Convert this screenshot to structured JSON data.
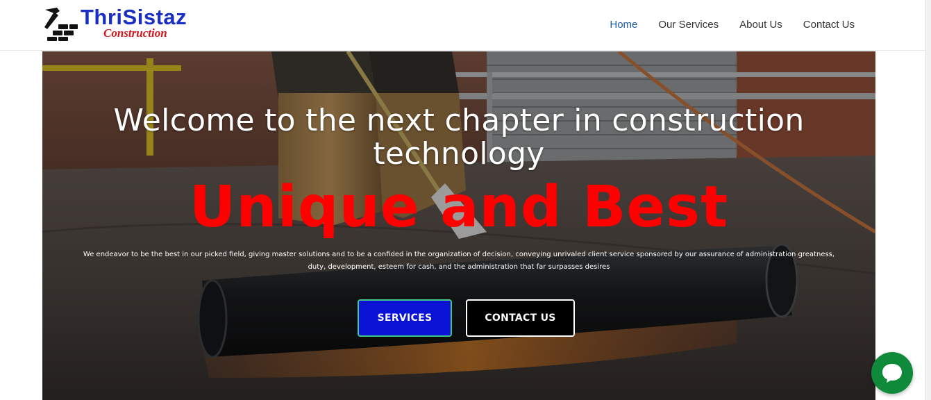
{
  "brand": {
    "name": "ThriSistaz",
    "subtitle": "Construction"
  },
  "nav": {
    "items": [
      {
        "label": "Home",
        "active": true
      },
      {
        "label": "Our Services",
        "active": false
      },
      {
        "label": "About Us",
        "active": false
      },
      {
        "label": "Contact Us",
        "active": false
      }
    ]
  },
  "hero": {
    "headline": "Welcome to the next chapter in construction technology",
    "tagline": "Unique and Best",
    "description": "We endeavor to be the best in our picked field, giving master solutions and to be a confided in the organization of decision, conveying unrivaled client service sponsored by our assurance of administration greatness, duty, development, esteem for cash, and the administration that far surpasses desires",
    "buttons": {
      "services": "SERVICES",
      "contact": "CONTACT US"
    }
  },
  "colors": {
    "brand_blue": "#1b2ec4",
    "brand_red": "#d4141a",
    "nav_active": "#1f5aa6",
    "tagline_red": "#ff0000",
    "services_button": "#0a12d6",
    "chat_green": "#0f8a3a"
  },
  "icons": {
    "logo": "hammer-bricks-icon",
    "chat": "chat-bubble-icon"
  }
}
